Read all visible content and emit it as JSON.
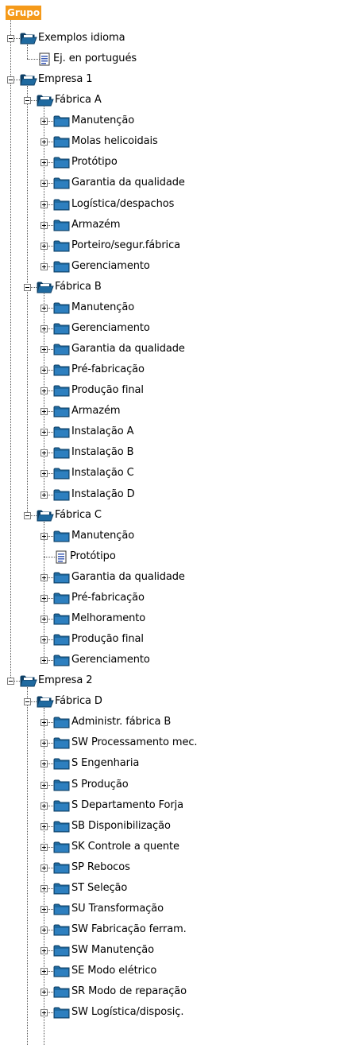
{
  "tree": {
    "root_label": "Grupo",
    "nodes": [
      {
        "label": "Exemplos idioma",
        "depth": 1,
        "type": "folder-open",
        "expander": "minus"
      },
      {
        "label": "Ej. en portugués",
        "depth": 2,
        "type": "document",
        "expander": "none"
      },
      {
        "label": "Empresa 1",
        "depth": 1,
        "type": "folder-open",
        "expander": "minus"
      },
      {
        "label": "Fábrica A",
        "depth": 2,
        "type": "folder-open",
        "expander": "minus"
      },
      {
        "label": "Manutenção",
        "depth": 3,
        "type": "folder",
        "expander": "plus"
      },
      {
        "label": "Molas helicoidais",
        "depth": 3,
        "type": "folder",
        "expander": "plus"
      },
      {
        "label": "Protótipo",
        "depth": 3,
        "type": "folder",
        "expander": "plus"
      },
      {
        "label": "Garantia da qualidade",
        "depth": 3,
        "type": "folder",
        "expander": "plus"
      },
      {
        "label": "Logística/despachos",
        "depth": 3,
        "type": "folder",
        "expander": "plus"
      },
      {
        "label": "Armazém",
        "depth": 3,
        "type": "folder",
        "expander": "plus"
      },
      {
        "label": "Porteiro/segur.fábrica",
        "depth": 3,
        "type": "folder",
        "expander": "plus"
      },
      {
        "label": "Gerenciamento",
        "depth": 3,
        "type": "folder",
        "expander": "plus"
      },
      {
        "label": "Fábrica B",
        "depth": 2,
        "type": "folder-open",
        "expander": "minus"
      },
      {
        "label": "Manutenção",
        "depth": 3,
        "type": "folder",
        "expander": "plus"
      },
      {
        "label": "Gerenciamento",
        "depth": 3,
        "type": "folder",
        "expander": "plus"
      },
      {
        "label": "Garantia da qualidade",
        "depth": 3,
        "type": "folder",
        "expander": "plus"
      },
      {
        "label": "Pré-fabricação",
        "depth": 3,
        "type": "folder",
        "expander": "plus"
      },
      {
        "label": "Produção final",
        "depth": 3,
        "type": "folder",
        "expander": "plus"
      },
      {
        "label": "Armazém",
        "depth": 3,
        "type": "folder",
        "expander": "plus"
      },
      {
        "label": "Instalação A",
        "depth": 3,
        "type": "folder",
        "expander": "plus"
      },
      {
        "label": "Instalação B",
        "depth": 3,
        "type": "folder",
        "expander": "plus"
      },
      {
        "label": "Instalação C",
        "depth": 3,
        "type": "folder",
        "expander": "plus"
      },
      {
        "label": "Instalação D",
        "depth": 3,
        "type": "folder",
        "expander": "plus"
      },
      {
        "label": "Fábrica C",
        "depth": 2,
        "type": "folder-open",
        "expander": "minus"
      },
      {
        "label": "Manutenção",
        "depth": 3,
        "type": "folder",
        "expander": "plus"
      },
      {
        "label": "Protótipo",
        "depth": 3,
        "type": "document",
        "expander": "none"
      },
      {
        "label": "Garantia da qualidade",
        "depth": 3,
        "type": "folder",
        "expander": "plus"
      },
      {
        "label": "Pré-fabricação",
        "depth": 3,
        "type": "folder",
        "expander": "plus"
      },
      {
        "label": "Melhoramento",
        "depth": 3,
        "type": "folder",
        "expander": "plus"
      },
      {
        "label": "Produção final",
        "depth": 3,
        "type": "folder",
        "expander": "plus"
      },
      {
        "label": "Gerenciamento",
        "depth": 3,
        "type": "folder",
        "expander": "plus"
      },
      {
        "label": "Empresa 2",
        "depth": 1,
        "type": "folder-open",
        "expander": "minus"
      },
      {
        "label": "Fábrica D",
        "depth": 2,
        "type": "folder-open",
        "expander": "minus"
      },
      {
        "label": "Administr. fábrica B",
        "depth": 3,
        "type": "folder",
        "expander": "plus"
      },
      {
        "label": "SW Processamento mec.",
        "depth": 3,
        "type": "folder",
        "expander": "plus"
      },
      {
        "label": "S Engenharia",
        "depth": 3,
        "type": "folder",
        "expander": "plus"
      },
      {
        "label": "S Produção",
        "depth": 3,
        "type": "folder",
        "expander": "plus"
      },
      {
        "label": "S Departamento Forja",
        "depth": 3,
        "type": "folder",
        "expander": "plus"
      },
      {
        "label": "SB Disponibilização",
        "depth": 3,
        "type": "folder",
        "expander": "plus"
      },
      {
        "label": "SK Controle a quente",
        "depth": 3,
        "type": "folder",
        "expander": "plus"
      },
      {
        "label": "SP Rebocos",
        "depth": 3,
        "type": "folder",
        "expander": "plus"
      },
      {
        "label": "ST Seleção",
        "depth": 3,
        "type": "folder",
        "expander": "plus"
      },
      {
        "label": "SU Transformação",
        "depth": 3,
        "type": "folder",
        "expander": "plus"
      },
      {
        "label": "SW Fabricação ferram.",
        "depth": 3,
        "type": "folder",
        "expander": "plus"
      },
      {
        "label": "SW Manutenção",
        "depth": 3,
        "type": "folder",
        "expander": "plus"
      },
      {
        "label": "SE Modo elétrico",
        "depth": 3,
        "type": "folder",
        "expander": "plus"
      },
      {
        "label": "SR Modo de reparação",
        "depth": 3,
        "type": "folder",
        "expander": "plus"
      },
      {
        "label": "SW Logística/disposiç.",
        "depth": 3,
        "type": "folder",
        "expander": "plus"
      }
    ]
  },
  "colors": {
    "root_highlight": "#f59a1a",
    "folder_fill": "#1f6aa0",
    "folder_dark": "#0d3f66",
    "document_fill": "#ffffff",
    "document_lines": "#3b5bb5"
  }
}
